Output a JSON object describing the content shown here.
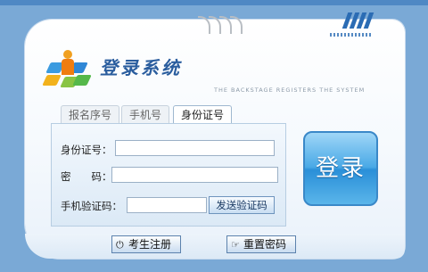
{
  "header": {
    "title": "登录系统",
    "subtitle": "THE BACKSTAGE REGISTERS THE SYSTEM"
  },
  "tabs": [
    {
      "label": "报名序号",
      "active": false
    },
    {
      "label": "手机号",
      "active": false
    },
    {
      "label": "身份证号",
      "active": true
    }
  ],
  "form": {
    "id_label": "身份证号：",
    "id_value": "",
    "password_label": "密　　码：",
    "password_value": "",
    "sms_label": "手机验证码：",
    "sms_value": "",
    "send_code_label": "发送验证码"
  },
  "login_label": "登录",
  "bottom": {
    "register_label": "考生注册",
    "reset_label": "重置密码"
  },
  "colors": {
    "background": "#7aa9d6",
    "accent": "#2a8fd8",
    "title": "#2a5d9e"
  }
}
